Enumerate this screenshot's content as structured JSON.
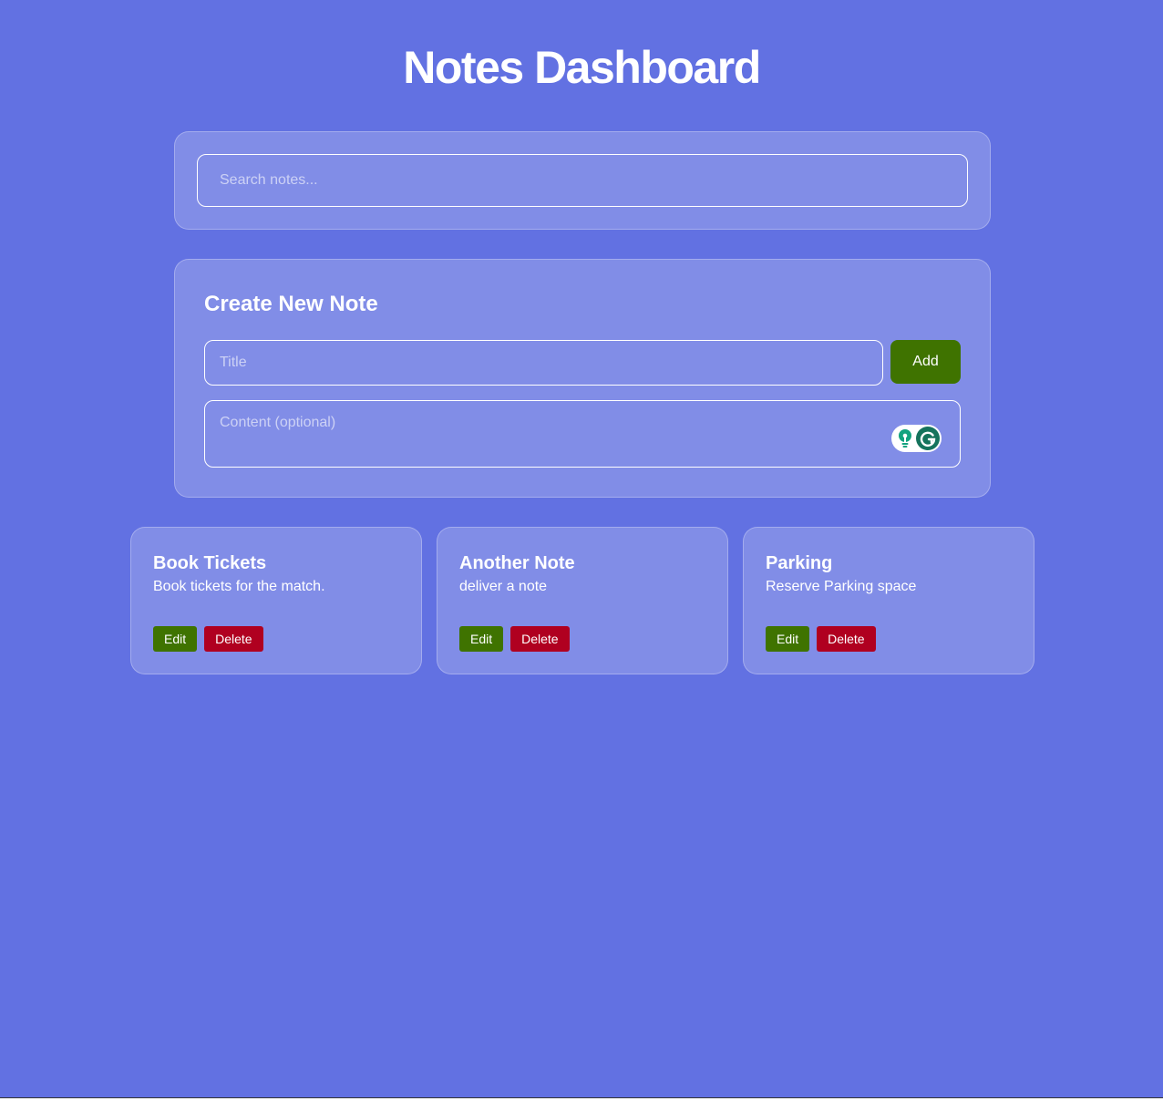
{
  "header": {
    "title": "Notes Dashboard"
  },
  "search": {
    "placeholder": "Search notes..."
  },
  "create": {
    "heading": "Create New Note",
    "title_placeholder": "Title",
    "content_placeholder": "Content (optional)",
    "add_label": "Add"
  },
  "notes": [
    {
      "title": "Book Tickets",
      "content": "Book tickets for the match.",
      "edit_label": "Edit",
      "delete_label": "Delete"
    },
    {
      "title": "Another Note",
      "content": "deliver a note",
      "edit_label": "Edit",
      "delete_label": "Delete"
    },
    {
      "title": "Parking",
      "content": "Reserve Parking space",
      "edit_label": "Edit",
      "delete_label": "Delete"
    }
  ],
  "icons": {
    "grammarly_suggestion": "lightbulb-icon",
    "grammarly_logo": "grammarly-g-icon"
  },
  "colors": {
    "background": "#6271e2",
    "edit_button": "#3f7300",
    "delete_button": "#b00020",
    "add_button": "#3f7300"
  }
}
